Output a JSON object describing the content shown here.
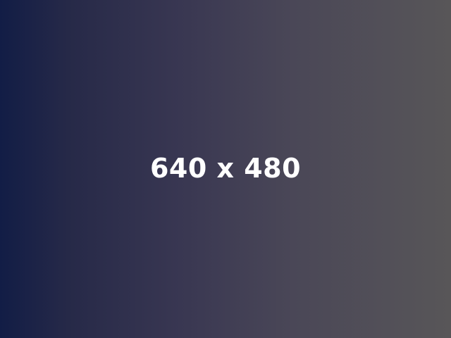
{
  "placeholder": {
    "label": "640 x 480"
  },
  "colors": {
    "gradient_start": "#121d46",
    "gradient_end": "#585658",
    "text": "#ffffff"
  }
}
